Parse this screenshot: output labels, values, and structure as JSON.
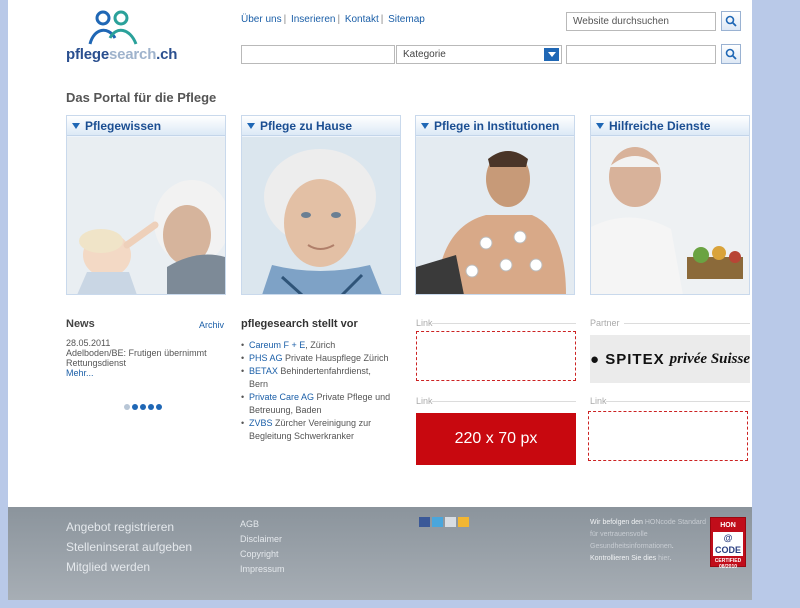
{
  "header": {
    "logo_text_a": "pflege",
    "logo_text_b": "search",
    "logo_text_c": ".ch",
    "toplinks": [
      "Über uns",
      "Inserieren",
      "Kontakt",
      "Sitemap"
    ],
    "search_placeholder": "Website durchsuchen",
    "category_select": "Kategorie"
  },
  "portal_title": "Das Portal für die Pflege",
  "categories": [
    {
      "label": "Pflegewissen"
    },
    {
      "label": "Pflege zu Hause"
    },
    {
      "label": "Pflege in Institutionen"
    },
    {
      "label": "Hilfreiche Dienste"
    }
  ],
  "news": {
    "title": "News",
    "archive": "Archiv",
    "date": "28.05.2011",
    "text": "Adelboden/BE: Frutigen übernimmt Rettungsdienst",
    "more": "Mehr...",
    "carousel_active": 1,
    "carousel_count": 5
  },
  "featured": {
    "title": "pflegesearch stellt vor",
    "items": [
      {
        "name": "Careum F + E",
        "text": ", Zürich"
      },
      {
        "name": "PHS AG",
        "text": " Private Hauspflege Zürich"
      },
      {
        "name": "BETAX",
        "text": " Behindertenfahrdienst, Bern"
      },
      {
        "name": "Private Care AG",
        "text": " Private Pflege und Betreuung, Baden"
      },
      {
        "name": "ZVBS",
        "text": " Zürcher Vereinigung zur Begleitung Schwerkranker"
      }
    ]
  },
  "ads": {
    "link_label": "Link",
    "partner_label": "Partner",
    "ad_size": "220 x 70 px",
    "spitex_a": "SPITEX",
    "spitex_b": "privée Suisse"
  },
  "footer": {
    "left_links": [
      "Angebot registrieren",
      "Stelleninserat aufgeben",
      "Mitglied werden"
    ],
    "links": [
      "AGB",
      "Disclaimer",
      "Copyright",
      "Impressum"
    ],
    "hon_text_1": "Wir befolgen den ",
    "hon_hl_1": "HONcode",
    "hon_hl_2": "Standard für vertrauensvolle Gesundheitsinformationen",
    "hon_text_2": ".",
    "hon_text_3": "Kontrollieren Sie dies ",
    "hon_hl_3": "hier",
    "hon_text_4": ".",
    "badge_top": "HON",
    "badge_mid": "@ CODE",
    "badge_bot": "CERTIFIED 08/2010"
  },
  "colors": {
    "accent": "#1f67b5",
    "ad_red": "#c8080f",
    "frame": "#b9c9e8"
  }
}
